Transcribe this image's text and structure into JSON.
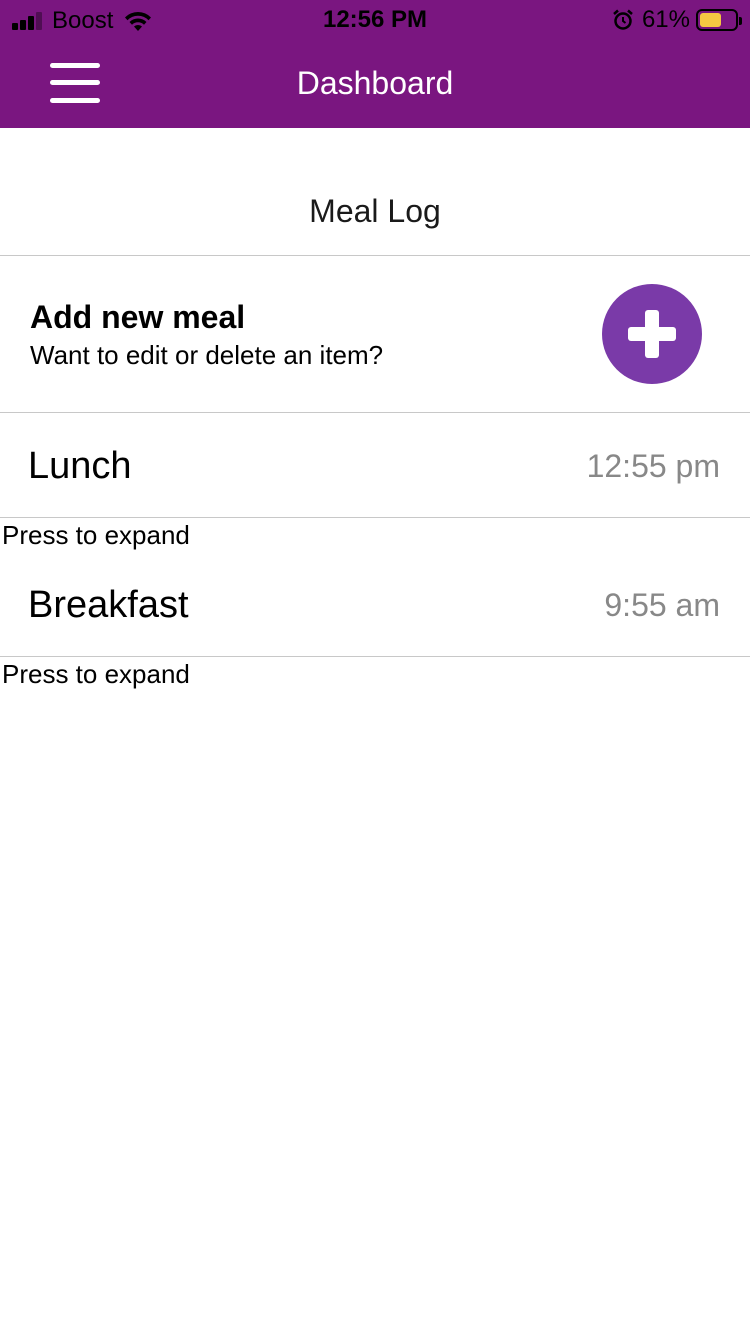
{
  "status_bar": {
    "carrier": "Boost",
    "time": "12:56 PM",
    "battery_percent": "61%",
    "battery_level": 0.61,
    "battery_color": "#f5c842",
    "icons": [
      "signal-icon",
      "wifi-icon",
      "alarm-icon",
      "battery-icon"
    ]
  },
  "header": {
    "title": "Dashboard",
    "menu_icon": "hamburger-menu-icon",
    "background_color": "#7a1680"
  },
  "main": {
    "section_title": "Meal Log",
    "add_meal": {
      "title": "Add new meal",
      "subtitle": "Want to edit or delete an item?",
      "button_icon": "plus-icon",
      "button_color": "#7a3aa8"
    },
    "meals": [
      {
        "name": "Lunch",
        "time": "12:55 pm",
        "hint": "Press to expand"
      },
      {
        "name": "Breakfast",
        "time": "9:55 am",
        "hint": "Press to expand"
      }
    ]
  }
}
